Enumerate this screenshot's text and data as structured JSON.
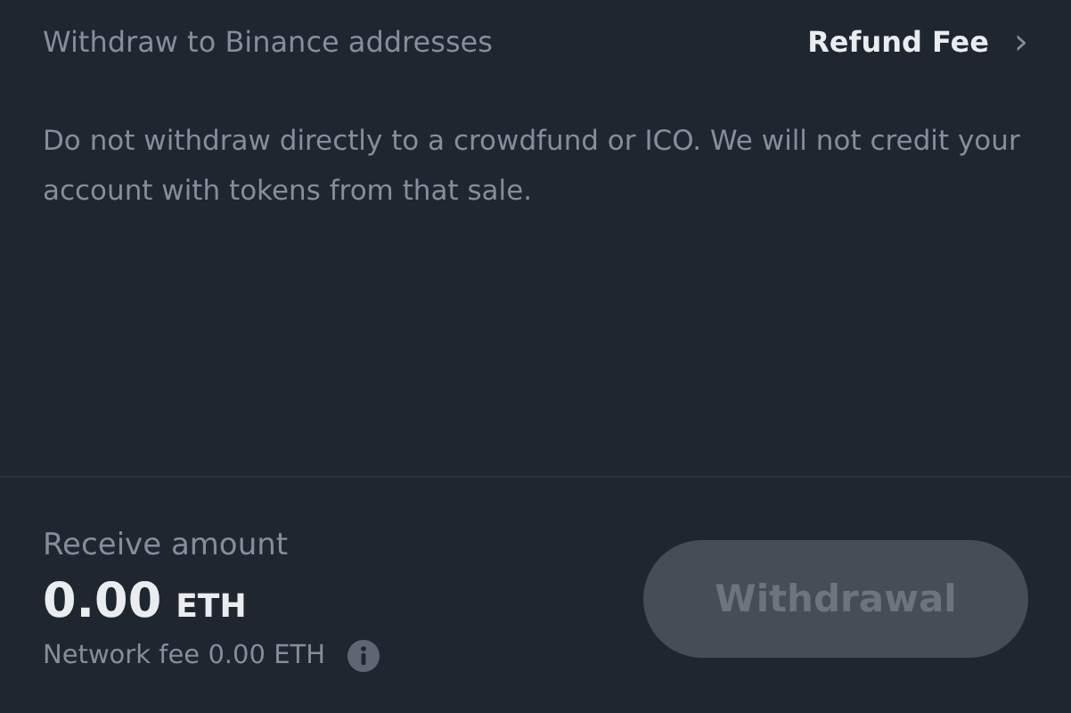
{
  "header": {
    "label": "Withdraw to Binance addresses",
    "link": "Refund Fee",
    "chevron": "›"
  },
  "notice": "Do not withdraw directly to a crowdfund or ICO. We will not credit your account with tokens from that sale.",
  "summary": {
    "label": "Receive amount",
    "amount": "0.00",
    "unit": "ETH",
    "fee": "Network fee 0.00 ETH"
  },
  "button": {
    "label": "Withdrawal",
    "disabled": true
  }
}
